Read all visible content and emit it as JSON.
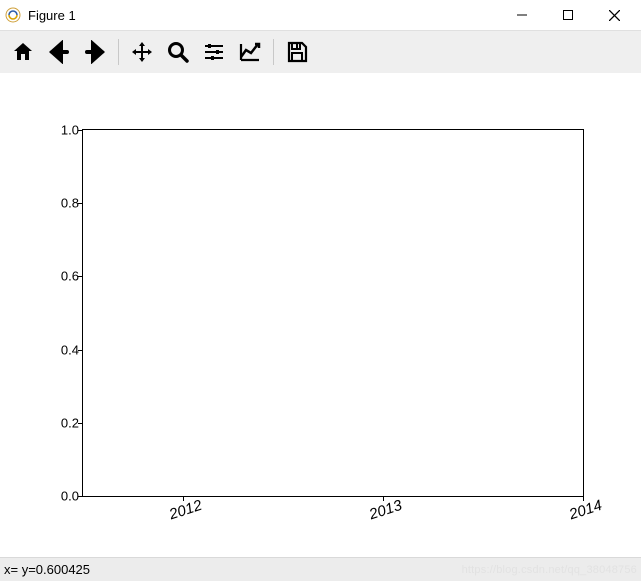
{
  "window": {
    "title": "Figure 1"
  },
  "toolbar": {
    "items": [
      {
        "name": "home-icon"
      },
      {
        "name": "back-icon"
      },
      {
        "name": "forward-icon"
      },
      {
        "sep": true
      },
      {
        "name": "pan-icon"
      },
      {
        "name": "zoom-icon"
      },
      {
        "name": "configure-subplots-icon"
      },
      {
        "name": "axis-edit-icon"
      },
      {
        "sep": true
      },
      {
        "name": "save-icon"
      }
    ]
  },
  "chart_data": {
    "type": "line",
    "series": [],
    "x_ticks": [
      "2012",
      "2013",
      "2014"
    ],
    "y_ticks": [
      "0.0",
      "0.2",
      "0.4",
      "0.6",
      "0.8",
      "1.0"
    ],
    "xlim": [
      "2011-07",
      "2014-01"
    ],
    "ylim": [
      0.0,
      1.0
    ],
    "title": "",
    "xlabel": "",
    "ylabel": ""
  },
  "status": {
    "coords": "x= y=0.600425",
    "watermark": "https://blog.csdn.net/qq_38048756"
  }
}
